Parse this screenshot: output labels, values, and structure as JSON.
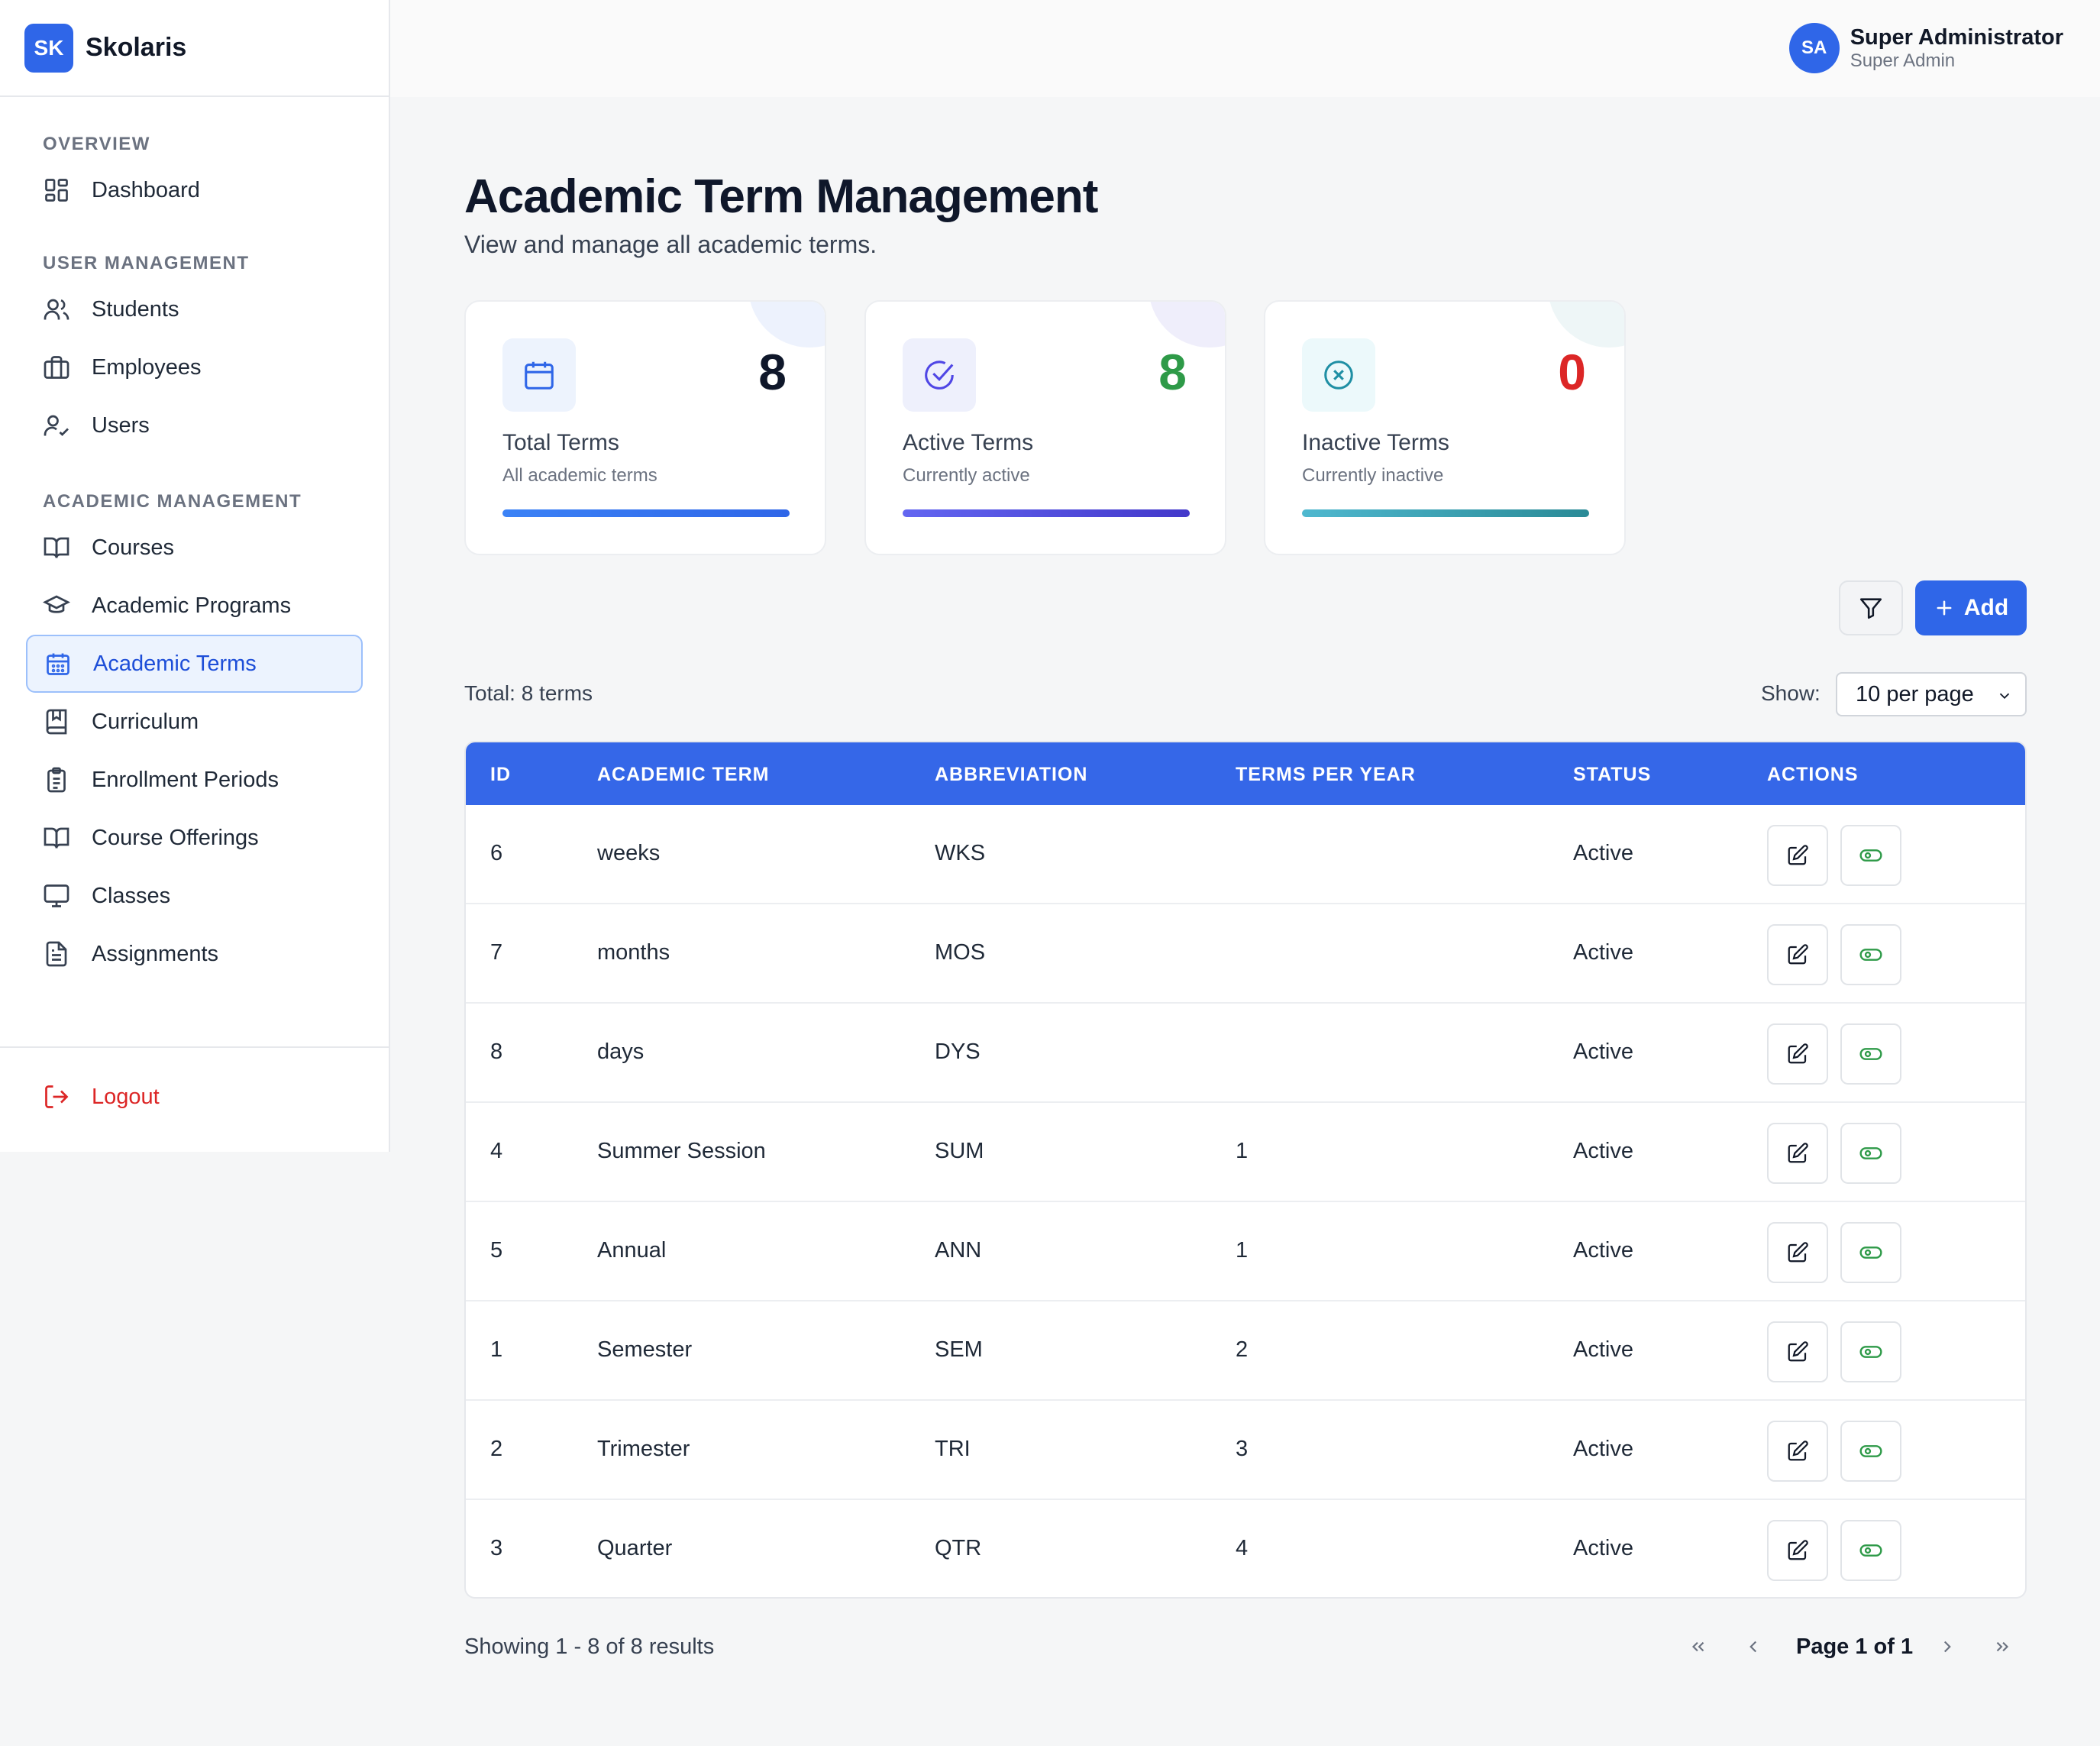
{
  "brand": {
    "logo": "SK",
    "name": "Skolaris"
  },
  "user": {
    "initials": "SA",
    "name": "Super Administrator",
    "role": "Super Admin"
  },
  "sidebar": {
    "sections": [
      {
        "title": "OVERVIEW",
        "items": [
          {
            "label": "Dashboard",
            "icon": "dashboard-icon"
          }
        ]
      },
      {
        "title": "USER MANAGEMENT",
        "items": [
          {
            "label": "Students",
            "icon": "users-icon"
          },
          {
            "label": "Employees",
            "icon": "briefcase-icon"
          },
          {
            "label": "Users",
            "icon": "user-check-icon"
          }
        ]
      },
      {
        "title": "ACADEMIC MANAGEMENT",
        "items": [
          {
            "label": "Courses",
            "icon": "book-open-icon"
          },
          {
            "label": "Academic Programs",
            "icon": "graduation-cap-icon"
          },
          {
            "label": "Academic Terms",
            "icon": "calendar-icon",
            "active": true
          },
          {
            "label": "Curriculum",
            "icon": "book-bookmark-icon"
          },
          {
            "label": "Enrollment Periods",
            "icon": "clipboard-list-icon"
          },
          {
            "label": "Course Offerings",
            "icon": "book-open-icon"
          },
          {
            "label": "Classes",
            "icon": "monitor-icon"
          },
          {
            "label": "Assignments",
            "icon": "file-text-icon"
          }
        ]
      }
    ],
    "logout": "Logout"
  },
  "page": {
    "title": "Academic Term Management",
    "subtitle": "View and manage all academic terms."
  },
  "cards": [
    {
      "value": "8",
      "label": "Total Terms",
      "sub": "All academic terms",
      "icon": "calendar-icon",
      "value_color": "#0f172a"
    },
    {
      "value": "8",
      "label": "Active Terms",
      "sub": "Currently active",
      "icon": "check-circle-icon",
      "value_color": "#2e9a48"
    },
    {
      "value": "0",
      "label": "Inactive Terms",
      "sub": "Currently inactive",
      "icon": "x-circle-icon",
      "value_color": "#dc2626"
    }
  ],
  "toolbar": {
    "add_label": "Add"
  },
  "list": {
    "total_text": "Total: 8 terms",
    "show_label": "Show:",
    "per_page": "10 per page"
  },
  "table": {
    "headers": [
      "ID",
      "ACADEMIC TERM",
      "ABBREVIATION",
      "TERMS PER YEAR",
      "STATUS",
      "ACTIONS"
    ],
    "rows": [
      {
        "id": "6",
        "term": "weeks",
        "abbr": "WKS",
        "tpy": "",
        "status": "Active"
      },
      {
        "id": "7",
        "term": "months",
        "abbr": "MOS",
        "tpy": "",
        "status": "Active"
      },
      {
        "id": "8",
        "term": "days",
        "abbr": "DYS",
        "tpy": "",
        "status": "Active"
      },
      {
        "id": "4",
        "term": "Summer Session",
        "abbr": "SUM",
        "tpy": "1",
        "status": "Active"
      },
      {
        "id": "5",
        "term": "Annual",
        "abbr": "ANN",
        "tpy": "1",
        "status": "Active"
      },
      {
        "id": "1",
        "term": "Semester",
        "abbr": "SEM",
        "tpy": "2",
        "status": "Active"
      },
      {
        "id": "2",
        "term": "Trimester",
        "abbr": "TRI",
        "tpy": "3",
        "status": "Active"
      },
      {
        "id": "3",
        "term": "Quarter",
        "abbr": "QTR",
        "tpy": "4",
        "status": "Active"
      }
    ]
  },
  "pagination": {
    "showing": "Showing 1 - 8 of 8 results",
    "page_label": "Page 1 of 1"
  },
  "colors": {
    "accent": "#2f66e8",
    "active_green": "#2e9a48",
    "danger": "#dc2626"
  }
}
